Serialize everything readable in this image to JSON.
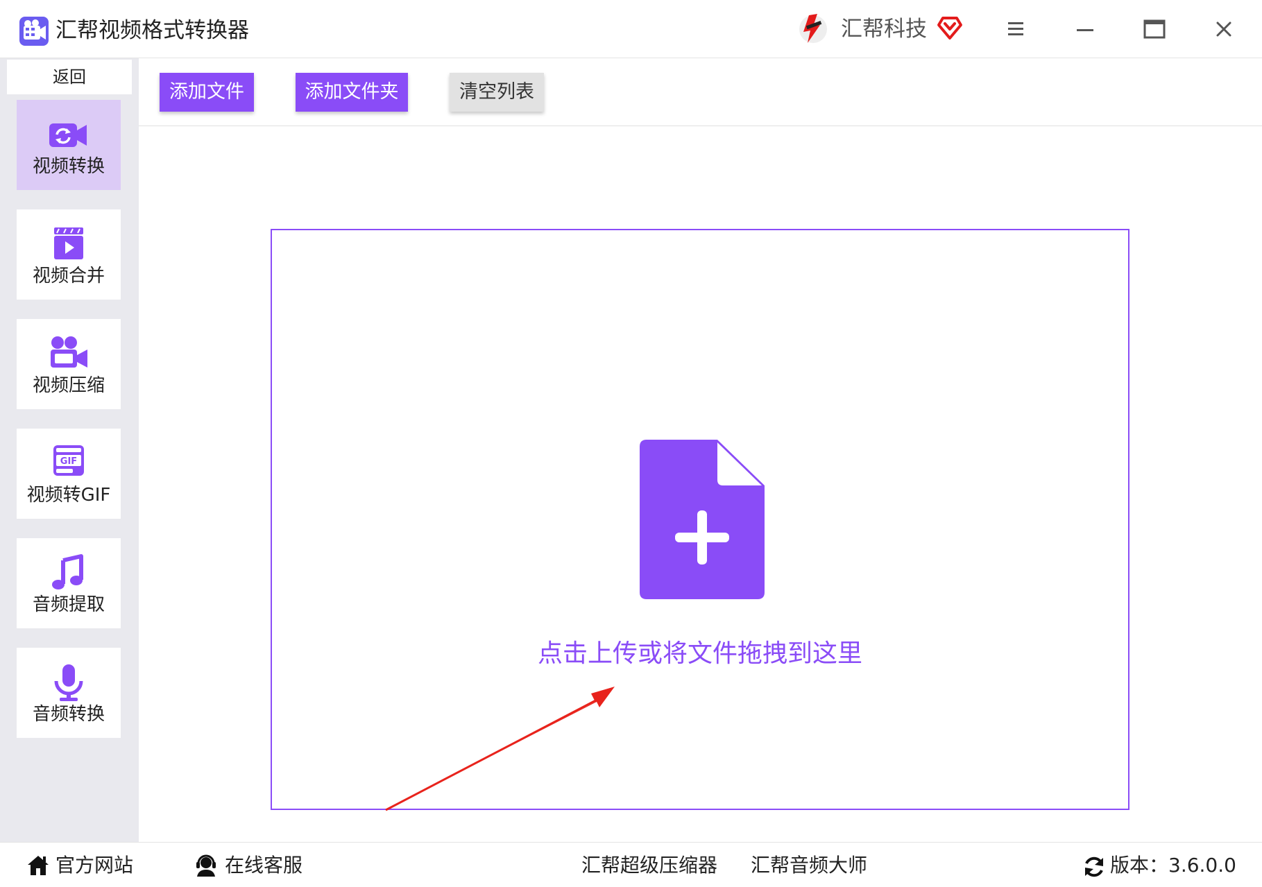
{
  "app": {
    "title": "汇帮视频格式转换器",
    "brand": "汇帮科技"
  },
  "colors": {
    "accent": "#8a4cf7",
    "active_nav_bg": "#dccbf6",
    "sidebar_bg": "#e9e9ee",
    "annotation_arrow": "#e8231c"
  },
  "sidebar": {
    "back_label": "返回",
    "items": [
      {
        "label": "视频转换",
        "icon": "video-convert-icon",
        "active": true
      },
      {
        "label": "视频合并",
        "icon": "video-merge-icon",
        "active": false
      },
      {
        "label": "视频压缩",
        "icon": "video-compress-icon",
        "active": false
      },
      {
        "label": "视频转GIF",
        "icon": "gif-icon",
        "active": false
      },
      {
        "label": "音频提取",
        "icon": "music-note-icon",
        "active": false
      },
      {
        "label": "音频转换",
        "icon": "microphone-icon",
        "active": false
      }
    ]
  },
  "toolbar": {
    "add_file": "添加文件",
    "add_folder": "添加文件夹",
    "clear_list": "清空列表"
  },
  "dropzone": {
    "text": "点击上传或将文件拖拽到这里",
    "icon": "file-add-icon"
  },
  "footer": {
    "website": "官方网站",
    "support": "在线客服",
    "compressor": "汇帮超级压缩器",
    "audio_master": "汇帮音频大师",
    "version_label": "版本：3.6.0.0"
  }
}
